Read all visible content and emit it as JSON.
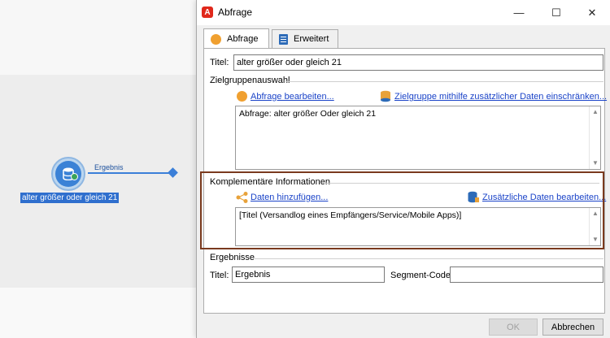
{
  "canvas": {
    "transition_label": "Ergebnis",
    "node_label": "alter größer oder gleich 21",
    "node_icon": "database-icon"
  },
  "dialog": {
    "title": "Abfrage",
    "window_controls": {
      "minimize": "—",
      "maximize": "☐",
      "close": "✕"
    },
    "tabs": [
      {
        "label": "Abfrage",
        "icon": "circle-icon",
        "active": true
      },
      {
        "label": "Erweitert",
        "icon": "clipboard-icon",
        "active": false
      }
    ],
    "title_field": {
      "label": "Titel:",
      "value": "alter größer oder gleich 21"
    },
    "target_selection": {
      "heading": "Zielgruppenauswahl",
      "edit_query_link": "Abfrage bearbeiten...",
      "restrict_link": "Zielgruppe mithilfe zusätzlicher Daten einschränken...",
      "summary": "Abfrage: alter größer Oder gleich 21"
    },
    "complementary": {
      "heading": "Komplementäre Informationen",
      "add_data_link": "Daten hinzufügen...",
      "edit_data_link": "Zusätzliche Daten bearbeiten...",
      "summary": "[Titel (Versandlog eines Empfängers/Service/Mobile Apps)]"
    },
    "results": {
      "heading": "Ergebnisse",
      "title_label": "Titel:",
      "title_value": "Ergebnis",
      "segment_label": "Segment-Code:",
      "segment_value": ""
    },
    "buttons": {
      "ok": "OK",
      "cancel": "Abbrechen"
    }
  },
  "colors": {
    "accent": "#1a43c8",
    "highlight_border": "#7a3a1e",
    "node_blue": "#3b82d6",
    "app_red": "#e0281b"
  }
}
